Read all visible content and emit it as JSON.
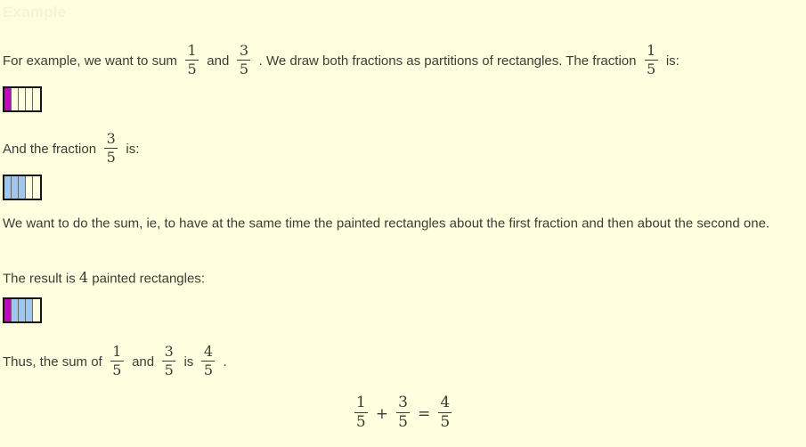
{
  "page": {
    "background_color": "#ffffe0",
    "text_color": "#3c3c34",
    "heading_color": "#f7f3d8"
  },
  "heading": {
    "label": "Example"
  },
  "paragraphs": {
    "intro_a": "For example, we want to sum",
    "intro_b": "and",
    "intro_c": ". We draw both fractions as partitions of rectangles. The fraction",
    "intro_d": "is:",
    "second_a": "And the fraction",
    "second_b": "is:",
    "explain": "We want to do the sum, ie, to have at the same time the painted rectangles about the first fraction and then about the second one.",
    "result_a": "The result is",
    "result_count": "4",
    "result_b": "painted rectangles:",
    "thus_a": "Thus, the sum of",
    "thus_b": "and",
    "thus_c": "is",
    "thus_d": "."
  },
  "fractions": {
    "one_fifth": {
      "numerator": "1",
      "denominator": "5"
    },
    "three_fifths": {
      "numerator": "3",
      "denominator": "5"
    },
    "four_fifths": {
      "numerator": "4",
      "denominator": "5"
    }
  },
  "equation": {
    "plus": "+",
    "equals": "=",
    "left": {
      "numerator": "1",
      "denominator": "5"
    },
    "middle": {
      "numerator": "3",
      "denominator": "5"
    },
    "right": {
      "numerator": "4",
      "denominator": "5"
    }
  },
  "diagrams": {
    "colors": {
      "magenta": "#cc00cc",
      "blue": "#9cc8f8",
      "border": "#141414",
      "divider": "#6b6b5a"
    },
    "first": {
      "total_cells": 5,
      "filled": 1,
      "cells": [
        "magenta",
        "none",
        "none",
        "none",
        "none"
      ]
    },
    "second": {
      "total_cells": 5,
      "filled": 3,
      "cells": [
        "blue",
        "blue",
        "blue",
        "none",
        "none"
      ]
    },
    "third": {
      "total_cells": 5,
      "filled": 4,
      "cells": [
        "magenta",
        "blue",
        "blue",
        "blue",
        "none"
      ]
    }
  }
}
